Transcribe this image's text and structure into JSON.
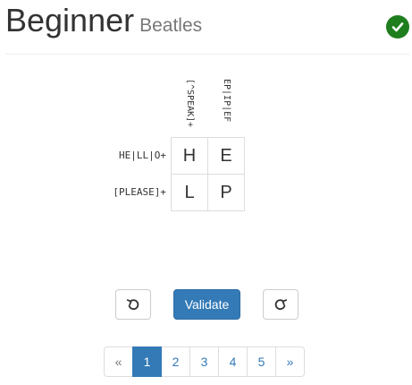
{
  "header": {
    "title": "Beginner",
    "subtitle": "Beatles",
    "status_icon": "check-circle-icon",
    "status_color": "#1e7e1e"
  },
  "puzzle": {
    "column_clues": [
      "[^SPEAK]+",
      "EP|IP|EF"
    ],
    "row_clues": [
      "HE|LL|O+",
      "[PLEASE]+"
    ],
    "cells": [
      [
        "H",
        "E"
      ],
      [
        "L",
        "P"
      ]
    ]
  },
  "controls": {
    "undo_icon": "undo-icon",
    "validate_label": "Validate",
    "redo_icon": "redo-icon",
    "accent_color": "#337ab7"
  },
  "pagination": {
    "prev_label": "«",
    "pages": [
      "1",
      "2",
      "3",
      "4",
      "5"
    ],
    "active_page": "1",
    "next_label": "»"
  }
}
